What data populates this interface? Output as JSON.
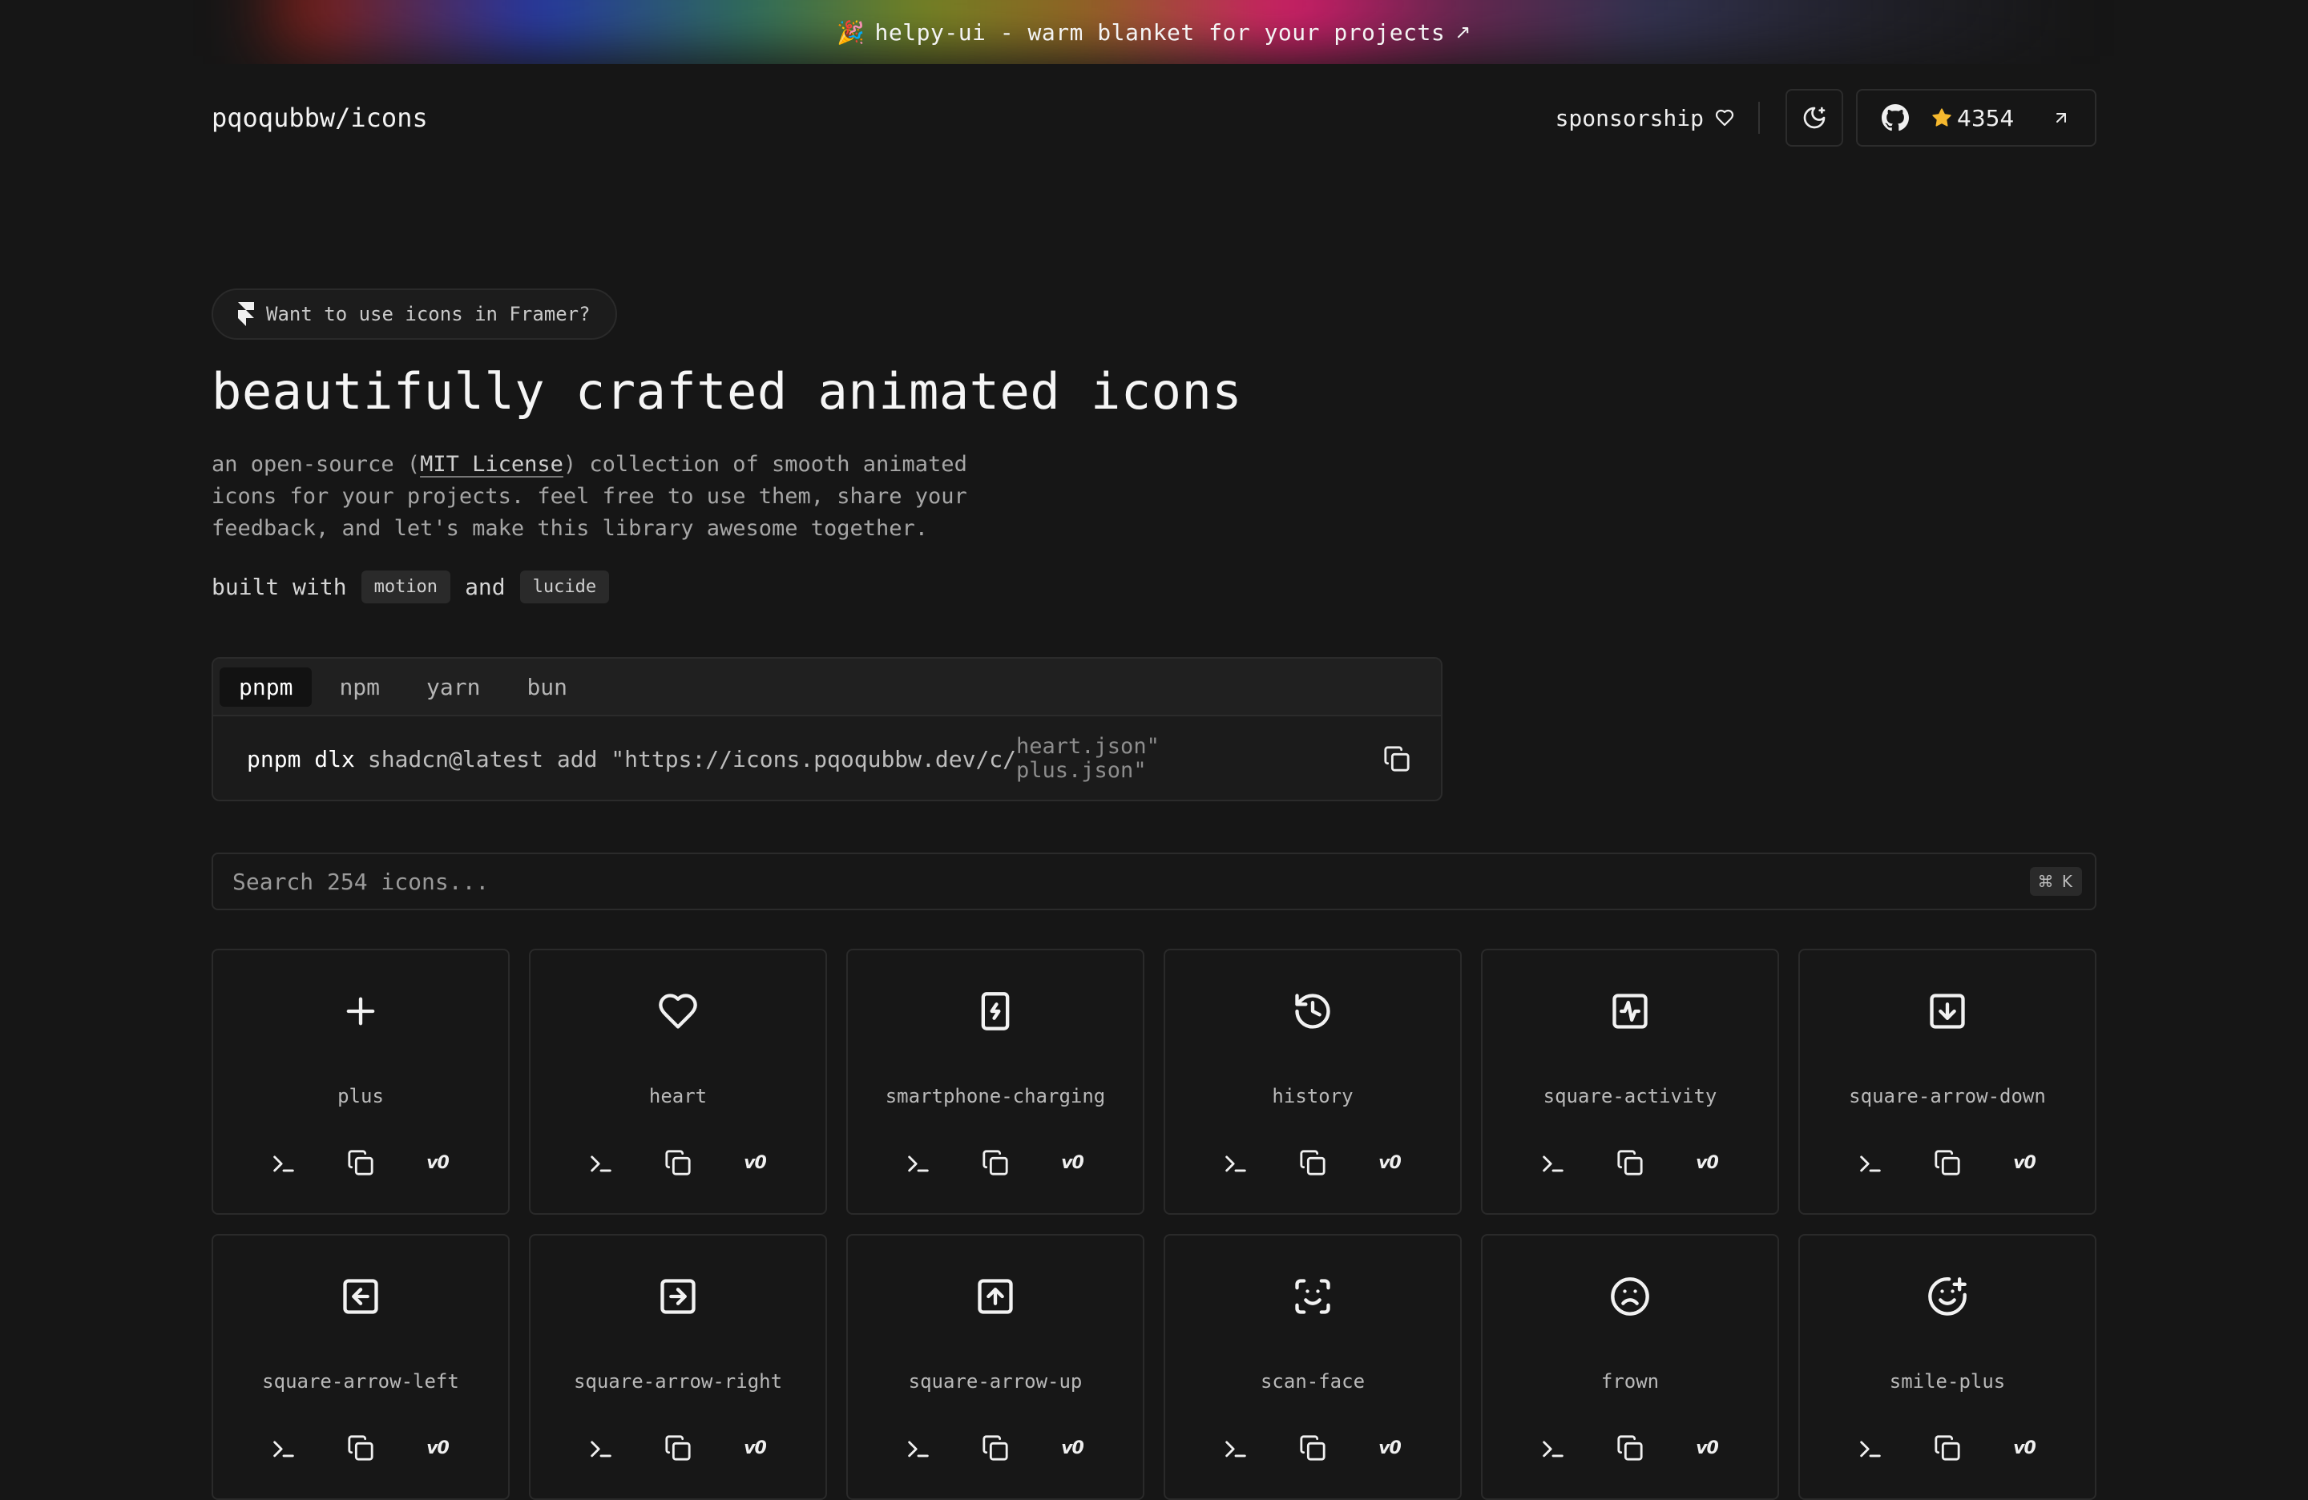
{
  "banner": {
    "emoji": "🎉",
    "text": "helpy-ui - warm blanket for your projects",
    "arrow": "↗"
  },
  "header": {
    "brand": "pqoqubbw/icons",
    "sponsor_label": "sponsorship",
    "github_stars": "4354"
  },
  "hero": {
    "framer_pill": "Want to use icons in Framer?",
    "title": "beautifully crafted animated icons",
    "desc_prefix": "an open-source (",
    "desc_link": "MIT License",
    "desc_suffix": ") collection of smooth animated icons for your projects. feel free to use them, share your feedback, and let's make this library awesome together.",
    "built_with": "built with",
    "and": "and",
    "chip_motion": "motion",
    "chip_lucide": "lucide"
  },
  "install": {
    "tabs": [
      "pnpm",
      "npm",
      "yarn",
      "bun"
    ],
    "active_tab": "pnpm",
    "cmd_main": "pnpm dlx",
    "cmd_args": "shadcn@latest add \"https://icons.pqoqubbw.dev/c/",
    "file_1": "heart.json\"",
    "file_2": "plus.json\""
  },
  "search": {
    "placeholder": "Search 254 icons...",
    "shortcut": "⌘ K"
  },
  "icons": [
    {
      "name": "plus",
      "icon": "plus-icon"
    },
    {
      "name": "heart",
      "icon": "heart-icon"
    },
    {
      "name": "smartphone-charging",
      "icon": "smartphone-charging-icon"
    },
    {
      "name": "history",
      "icon": "history-icon"
    },
    {
      "name": "square-activity",
      "icon": "square-activity-icon"
    },
    {
      "name": "square-arrow-down",
      "icon": "square-arrow-down-icon"
    },
    {
      "name": "square-arrow-left",
      "icon": "square-arrow-left-icon"
    },
    {
      "name": "square-arrow-right",
      "icon": "square-arrow-right-icon"
    },
    {
      "name": "square-arrow-up",
      "icon": "square-arrow-up-icon"
    },
    {
      "name": "scan-face",
      "icon": "scan-face-icon"
    },
    {
      "name": "frown",
      "icon": "frown-icon"
    },
    {
      "name": "smile-plus",
      "icon": "smile-plus-icon"
    }
  ],
  "card_actions": {
    "v0_label": "v0"
  },
  "colors": {
    "background": "#161616",
    "star": "#f5b82e",
    "text": "#ededed"
  }
}
